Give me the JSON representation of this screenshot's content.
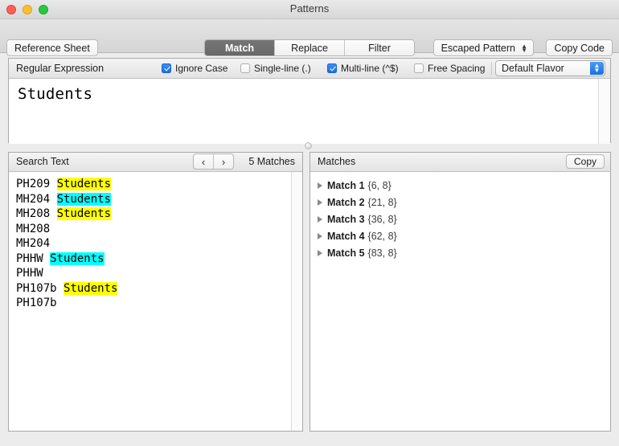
{
  "window": {
    "title": "Patterns",
    "traffic_lights": [
      "close-button",
      "minimize-button",
      "zoom-button"
    ]
  },
  "toolbar": {
    "reference_sheet_label": "Reference Sheet",
    "modes": [
      {
        "label": "Match",
        "active": true
      },
      {
        "label": "Replace",
        "active": false
      },
      {
        "label": "Filter",
        "active": false
      }
    ],
    "escaped_pattern_label": "Escaped Pattern",
    "copy_code_label": "Copy Code"
  },
  "regex_pane": {
    "label": "Regular Expression",
    "options": [
      {
        "label": "Ignore Case",
        "checked": true
      },
      {
        "label": "Single-line (.)",
        "checked": false
      },
      {
        "label": "Multi-line (^$)",
        "checked": true
      },
      {
        "label": "Free Spacing",
        "checked": false
      }
    ],
    "flavor": "Default Flavor",
    "pattern": "Students"
  },
  "search_pane": {
    "title": "Search Text",
    "prev_glyph": "‹",
    "next_glyph": "›",
    "match_count_label": "5 Matches",
    "lines": [
      {
        "prefix": "PH209 ",
        "match": "Students",
        "highlight": "yellow"
      },
      {
        "prefix": "MH204 ",
        "match": "Students",
        "highlight": "cyan"
      },
      {
        "prefix": "MH208 ",
        "match": "Students",
        "highlight": "yellow"
      },
      {
        "prefix": "MH208",
        "match": "",
        "highlight": "none"
      },
      {
        "prefix": "MH204",
        "match": "",
        "highlight": "none"
      },
      {
        "prefix": "PHHW ",
        "match": "Students",
        "highlight": "cyan"
      },
      {
        "prefix": "PHHW",
        "match": "",
        "highlight": "none"
      },
      {
        "prefix": "PH107b ",
        "match": "Students",
        "highlight": "yellow"
      },
      {
        "prefix": "PH107b",
        "match": "",
        "highlight": "none"
      }
    ]
  },
  "matches_pane": {
    "title": "Matches",
    "copy_label": "Copy",
    "rows": [
      {
        "name": "Match 1",
        "range": "{6, 8}"
      },
      {
        "name": "Match 2",
        "range": "{21, 8}"
      },
      {
        "name": "Match 3",
        "range": "{36, 8}"
      },
      {
        "name": "Match 4",
        "range": "{62, 8}"
      },
      {
        "name": "Match 5",
        "range": "{83, 8}"
      }
    ]
  },
  "colors": {
    "highlight_current": "#00ffff",
    "highlight_other": "#ffff00",
    "accent": "#1a6fe0",
    "segment_active_bg": "#6e6e6e"
  }
}
